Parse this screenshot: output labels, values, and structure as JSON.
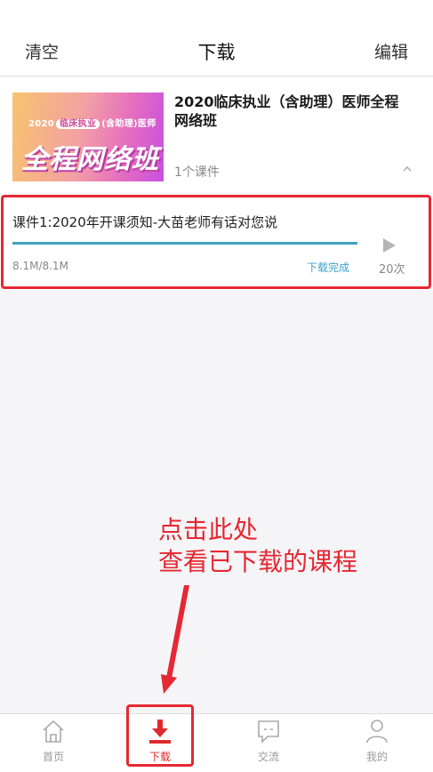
{
  "header": {
    "left_label": "清空",
    "title": "下载",
    "right_label": "编辑"
  },
  "course": {
    "thumb": {
      "year": "2020",
      "tag1": "临床执业",
      "tag2": "含助理",
      "tag3": "医师",
      "big": "全程网络班"
    },
    "title": "2020临床执业（含助理）医师全程网络班",
    "count": "1个课件",
    "collapse_icon": "chevron-up-icon"
  },
  "lesson": {
    "title": "课件1:2020年开课须知-大苗老师有话对您说",
    "size": "8.1M/8.1M",
    "status": "下载完成",
    "play_count": "20次",
    "progress": 1.0
  },
  "annotation": {
    "line1": "点击此处",
    "line2": "查看已下载的课程"
  },
  "tabs": [
    {
      "label": "首页",
      "icon": "home-icon",
      "active": false
    },
    {
      "label": "下载",
      "icon": "download-icon",
      "active": true
    },
    {
      "label": "交流",
      "icon": "chat-icon",
      "active": false
    },
    {
      "label": "我的",
      "icon": "user-icon",
      "active": false
    }
  ],
  "colors": {
    "accent": "#e02b2e",
    "highlight": "#e62833",
    "progress": "#3fa2c0",
    "status": "#3aa4cc"
  }
}
